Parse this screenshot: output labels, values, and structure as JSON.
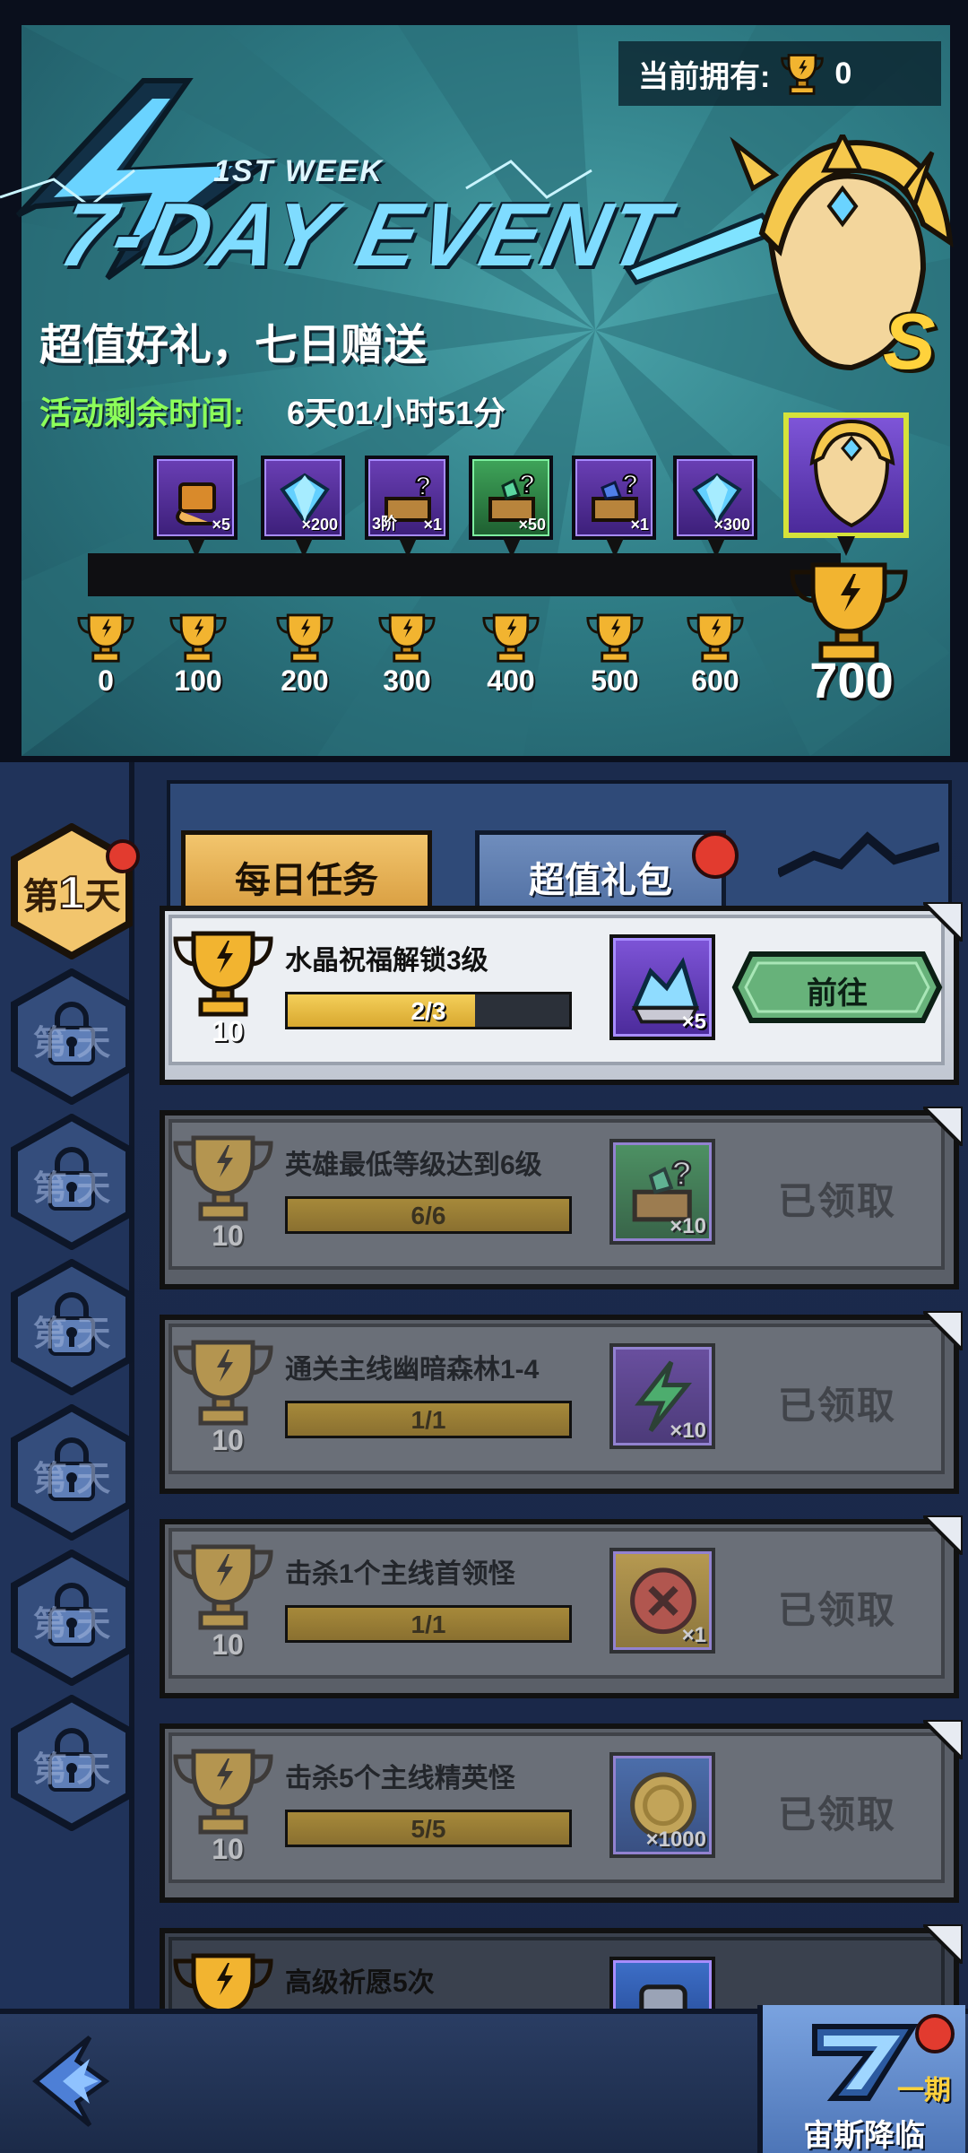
{
  "colors": {
    "accent_gold": "#f2c56d",
    "timer_green": "#8cff5a",
    "go_button_green": "#67b27a",
    "red_notification": "#e23b2f",
    "panel_blue": "#2f4a78"
  },
  "header": {
    "owned_label": "当前拥有:",
    "owned_count": "0",
    "event_week": "1ST WEEK",
    "event_title": "7-DAY EVENT",
    "slogan": "超值好礼，七日赠送",
    "timer_label": "活动剩余时间:",
    "timer_value": "6天01小时51分",
    "hero_rank": "S"
  },
  "rewards": [
    {
      "icon": "scroll-icon",
      "qty": "×5",
      "tier": ""
    },
    {
      "icon": "diamond-icon",
      "qty": "×200",
      "tier": ""
    },
    {
      "icon": "mystery-chest-icon",
      "qty": "×1",
      "tier": "3阶"
    },
    {
      "icon": "mystery-chest-green-icon",
      "qty": "×50",
      "tier": ""
    },
    {
      "icon": "mystery-chest-blue-icon",
      "qty": "×1",
      "tier": ""
    },
    {
      "icon": "diamond-icon",
      "qty": "×300",
      "tier": ""
    }
  ],
  "milestones": [
    "0",
    "100",
    "200",
    "300",
    "400",
    "500",
    "600"
  ],
  "grand_milestone": "700",
  "days": {
    "active_prefix": "第",
    "active_number": "1",
    "active_suffix": "天",
    "locked_text": "第  天"
  },
  "tabs": {
    "daily": "每日任务",
    "bundle": "超值礼包"
  },
  "tasks": [
    {
      "name": "水晶祝福解锁3级",
      "points": "10",
      "progress": "2/3",
      "progress_fraction": 0.667,
      "item_icon": "crystal-icon",
      "item_qty": "×5",
      "status": "active",
      "action": "前往"
    },
    {
      "name": "英雄最低等级达到6级",
      "points": "10",
      "progress": "6/6",
      "progress_fraction": 1.0,
      "item_icon": "mystery-chest-green-icon",
      "item_qty": "×10",
      "status": "claimed",
      "action": "已领取"
    },
    {
      "name": "通关主线幽暗森林1-4",
      "points": "10",
      "progress": "1/1",
      "progress_fraction": 1.0,
      "item_icon": "lightning-icon",
      "item_qty": "×10",
      "status": "claimed",
      "action": "已领取"
    },
    {
      "name": "击杀1个主线首领怪",
      "points": "10",
      "progress": "1/1",
      "progress_fraction": 1.0,
      "item_icon": "red-seal-icon",
      "item_qty": "×1",
      "status": "claimed",
      "action": "已领取"
    },
    {
      "name": "击杀5个主线精英怪",
      "points": "10",
      "progress": "5/5",
      "progress_fraction": 1.0,
      "item_icon": "gold-coin-icon",
      "item_qty": "×1000",
      "status": "claimed",
      "action": "已领取"
    },
    {
      "name": "高级祈愿5次",
      "points": "",
      "progress": "",
      "progress_fraction": 0,
      "item_icon": "item-icon",
      "item_qty": "",
      "status": "partial",
      "action": ""
    }
  ],
  "bottom": {
    "event_label": "宙斯降临",
    "event_phase": "一期"
  }
}
